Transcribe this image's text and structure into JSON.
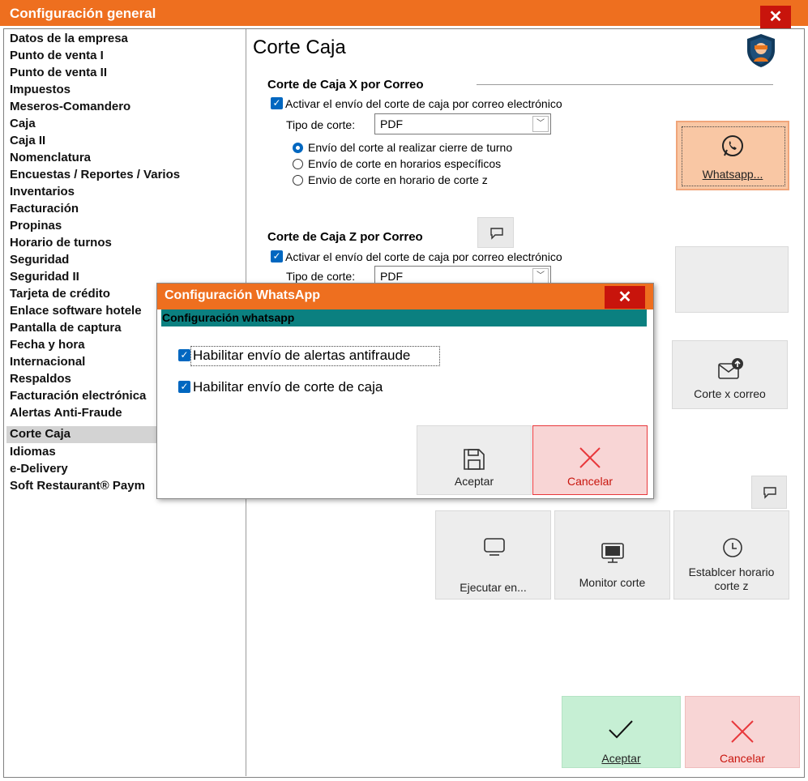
{
  "window": {
    "title": "Configuración general",
    "close_glyph": "✕"
  },
  "sidebar": {
    "items": [
      {
        "label": "Datos de la empresa"
      },
      {
        "label": "Punto de venta I"
      },
      {
        "label": "Punto de venta II"
      },
      {
        "label": "Impuestos"
      },
      {
        "label": "Meseros-Comandero"
      },
      {
        "label": "Caja"
      },
      {
        "label": "Caja II"
      },
      {
        "label": "Nomenclatura"
      },
      {
        "label": "Encuestas / Reportes / Varios"
      },
      {
        "label": "Inventarios"
      },
      {
        "label": "Facturación"
      },
      {
        "label": "Propinas"
      },
      {
        "label": "Horario de turnos"
      },
      {
        "label": "Seguridad"
      },
      {
        "label": "Seguridad II"
      },
      {
        "label": "Tarjeta de crédito"
      },
      {
        "label": "Enlace software hotele"
      },
      {
        "label": "Pantalla de captura"
      },
      {
        "label": "Fecha y hora"
      },
      {
        "label": "Internacional"
      },
      {
        "label": "Respaldos"
      },
      {
        "label": "Facturación electrónica"
      },
      {
        "label": "Alertas Anti-Fraude"
      },
      {
        "label": "Corte Caja"
      },
      {
        "label": "Idiomas"
      },
      {
        "label": "e-Delivery"
      },
      {
        "label": "Soft Restaurant® Paym"
      }
    ],
    "selected": "Corte Caja"
  },
  "main": {
    "title": "Corte Caja",
    "section_x": {
      "heading": "Corte de Caja X por Correo",
      "enable_label": "Activar el envío del corte de caja por correo electrónico",
      "type_label": "Tipo de corte:",
      "type_value": "PDF",
      "radios": [
        {
          "label": "Envío del corte al realizar cierre de turno",
          "selected": true
        },
        {
          "label": "Envío de corte en horarios específicos",
          "selected": false
        },
        {
          "label": "Envio de corte en horario de corte z",
          "selected": false
        }
      ]
    },
    "section_z": {
      "heading": "Corte de Caja Z por Correo",
      "enable_label": "Activar el envío del corte de caja por correo electrónico",
      "type_label": "Tipo de corte:",
      "type_value": "PDF"
    },
    "buttons": {
      "whatsapp": "Whatsapp...",
      "corte_correo": "Corte x correo",
      "ejecutar": "Ejecutar en...",
      "monitor": "Monitor corte",
      "establecer": "Establcer horario corte z",
      "aceptar": "Aceptar",
      "cancelar": "Cancelar"
    }
  },
  "dialog": {
    "title": "Configuración WhatsApp",
    "band": "Configuración whatsapp",
    "options": [
      {
        "label": "Habilitar envío de alertas antifraude",
        "checked": true
      },
      {
        "label": "Habilitar envío de corte de caja",
        "checked": true
      }
    ],
    "aceptar": "Aceptar",
    "cancelar": "Cancelar",
    "close_glyph": "✕"
  },
  "icons": {
    "check": "✓",
    "dropdown": "﹀"
  },
  "colors": {
    "title_orange": "#EE6F1F",
    "close_red": "#C8140C",
    "band_teal": "#0B8080",
    "check_blue": "#0067C0",
    "accept_green": "#C6EFD4",
    "cancel_pink": "#F8D5D5",
    "cancel_red": "#E8383C"
  }
}
